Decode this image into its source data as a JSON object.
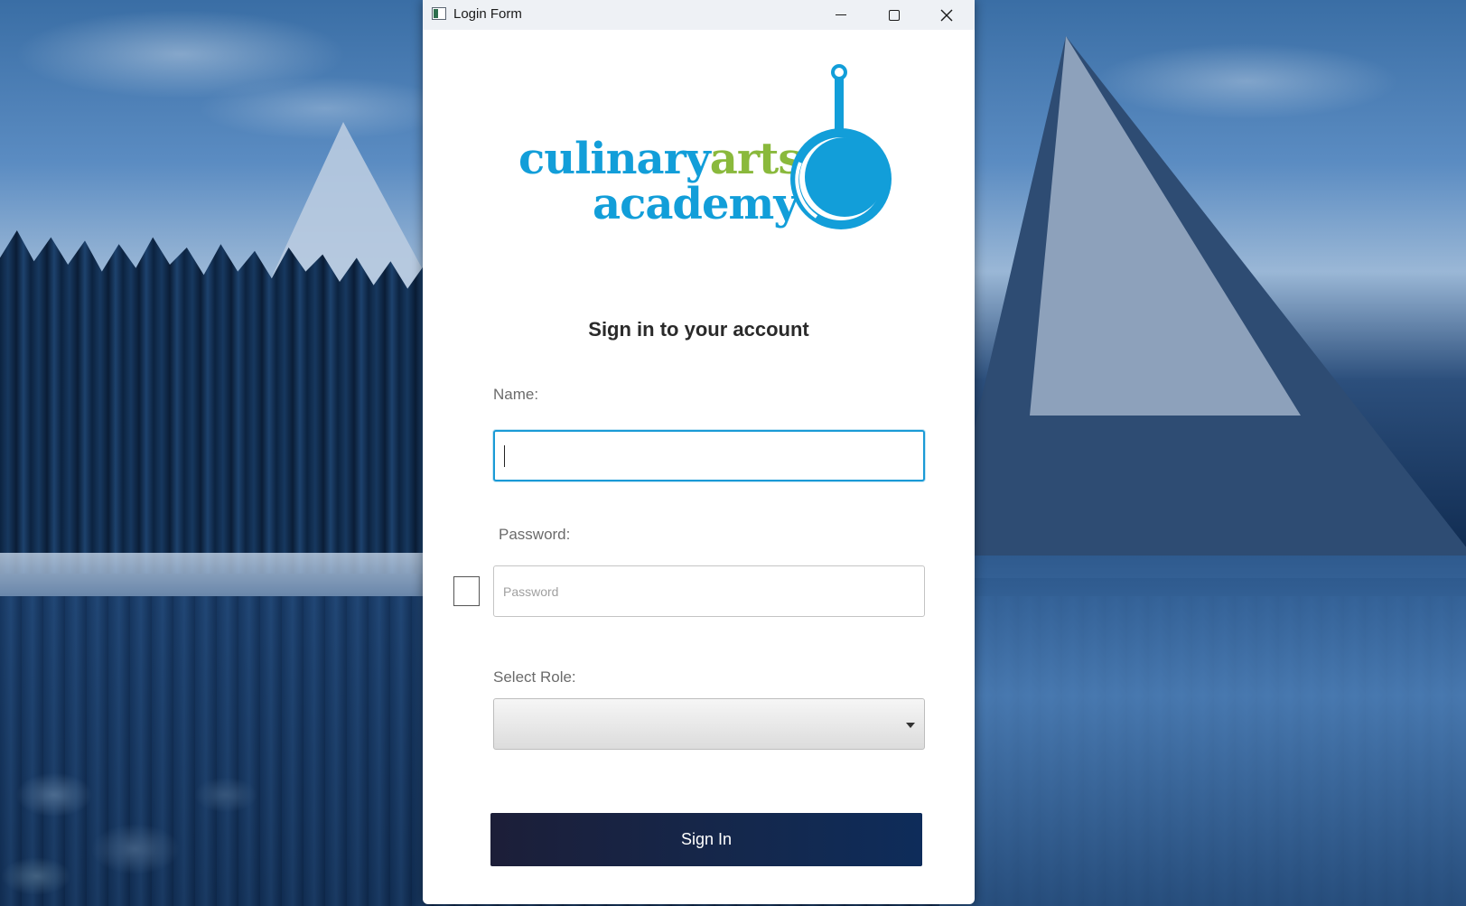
{
  "window": {
    "title": "Login Form",
    "minimize_icon": "minimize-icon",
    "maximize_icon": "maximize-icon",
    "close_icon": "close-icon"
  },
  "logo": {
    "line1_part1": "culinary",
    "line1_part2": "arts",
    "line2": "academy",
    "icon": "frying-pan-icon",
    "colors": {
      "primary": "#129ed9",
      "accent": "#8ab93c"
    }
  },
  "form": {
    "heading": "Sign in to your account",
    "name_label": "Name:",
    "name_value": "",
    "password_label": "Password:",
    "password_placeholder": "Password",
    "show_password_checked": false,
    "role_label": "Select Role:",
    "role_value": "",
    "submit_label": "Sign In"
  },
  "colors": {
    "focus_border": "#1a9ad6",
    "button_bg": "#14284d",
    "button_text": "#ffffff"
  }
}
